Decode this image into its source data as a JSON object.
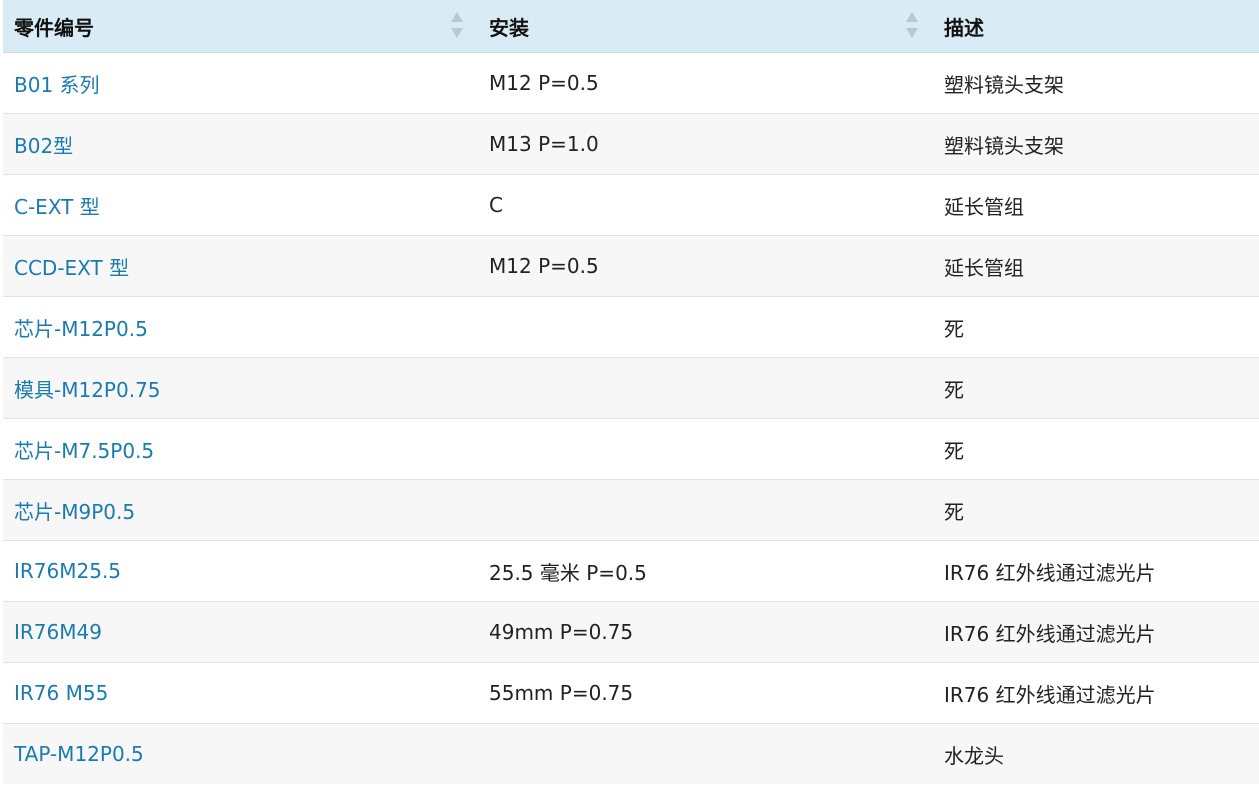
{
  "table": {
    "headers": [
      "零件编号",
      "安装",
      "描述"
    ],
    "rows": [
      {
        "part": "B01 系列",
        "mount": "M12 P=0.5",
        "desc": "塑料镜头支架"
      },
      {
        "part": "B02型",
        "mount": "M13 P=1.0",
        "desc": "塑料镜头支架"
      },
      {
        "part": "C-EXT 型",
        "mount": "C",
        "desc": "延长管组"
      },
      {
        "part": "CCD-EXT 型",
        "mount": "M12 P=0.5",
        "desc": "延长管组"
      },
      {
        "part": "芯片-M12P0.5",
        "mount": "",
        "desc": "死"
      },
      {
        "part": "模具-M12P0.75",
        "mount": "",
        "desc": "死"
      },
      {
        "part": "芯片-M7.5P0.5",
        "mount": "",
        "desc": "死"
      },
      {
        "part": "芯片-M9P0.5",
        "mount": "",
        "desc": "死"
      },
      {
        "part": "IR76M25.5",
        "mount": "25.5 毫米 P=0.5",
        "desc": "IR76 红外线通过滤光片"
      },
      {
        "part": "IR76M49",
        "mount": "49mm P=0.75",
        "desc": "IR76 红外线通过滤光片"
      },
      {
        "part": "IR76 M55",
        "mount": "55mm P=0.75",
        "desc": "IR76 红外线通过滤光片"
      },
      {
        "part": "TAP-M12P0.5",
        "mount": "",
        "desc": "水龙头"
      }
    ]
  },
  "colors": {
    "header_bg": "#d9ecf6",
    "link": "#1a7bb0",
    "row_alt": "#f7f7f7",
    "sort_icon": "#b9c8d2"
  },
  "icons": {
    "sort": "sort-icon"
  }
}
